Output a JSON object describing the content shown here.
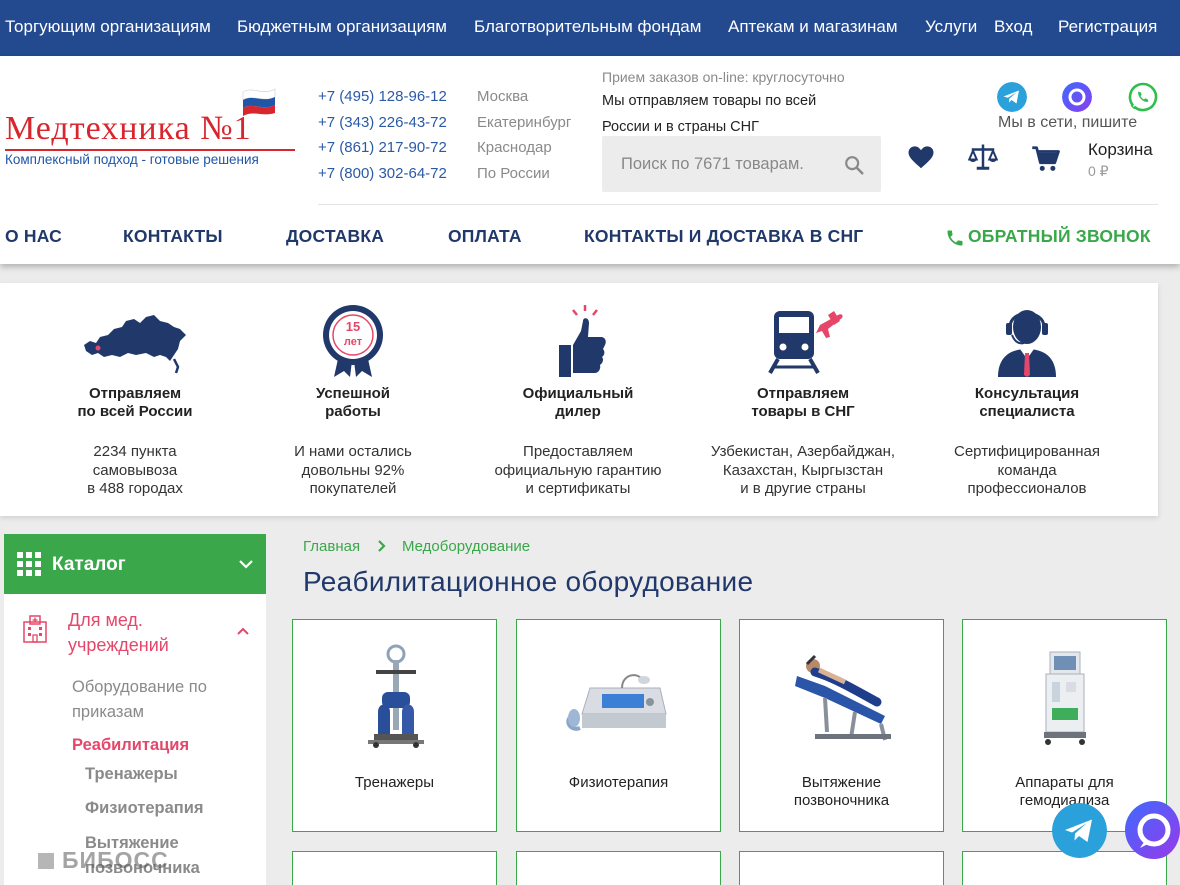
{
  "topbar": {
    "links": [
      "Торгующим организациям",
      "Бюджетным организациям",
      "Благотворительным фондам",
      "Аптекам и магазинам",
      "Услуги",
      "Вход",
      "Регистрация"
    ]
  },
  "logo": {
    "title": "Медтехника №1",
    "tagline": "Комплексный подход - готовые решения"
  },
  "phones": [
    {
      "number": "+7 (495) 128-96-12",
      "city": "Москва"
    },
    {
      "number": "+7 (343) 226-43-72",
      "city": "Екатеринбург"
    },
    {
      "number": "+7 (861) 217-90-72",
      "city": "Краснодар"
    },
    {
      "number": "+7 (800) 302-64-72",
      "city": "По России"
    }
  ],
  "orders": {
    "hint": "Прием заказов on-line: круглосуточно",
    "shipping": "Мы отправляем товары по всей России и в страны СНГ"
  },
  "search": {
    "placeholder": "Поиск по 7671 товарам."
  },
  "social": {
    "caption": "Мы в сети, пишите",
    "icons": [
      "telegram-icon",
      "max-messenger-icon",
      "whatsapp-icon"
    ]
  },
  "cart": {
    "title": "Корзина",
    "sum": "0 ₽"
  },
  "nav": {
    "about": "О НАС",
    "contacts": "КОНТАКТЫ",
    "delivery": "ДОСТАВКА",
    "payment": "ОПЛАТА",
    "cis": "КОНТАКТЫ И ДОСТАВКА В СНГ",
    "callback": "ОБРАТНЫЙ ЗВОНОК"
  },
  "features": [
    {
      "title1": "Отправляем",
      "title2": "по всей России",
      "d1": "2234 пункта",
      "d2": "самовывоза",
      "d3": "в 488 городах",
      "icon": "russia-map-icon"
    },
    {
      "title1": "Успешной",
      "title2": "работы",
      "d1": "И нами остались",
      "d2": "довольны 92%",
      "d3": "покупателей",
      "icon": "award-15-years-icon",
      "badge_top": "15",
      "badge_bottom": "лет"
    },
    {
      "title1": "Официальный",
      "title2": "дилер",
      "d1": "Предоставляем",
      "d2": "официальную гарантию",
      "d3": "и сертификаты",
      "icon": "thumbs-up-icon"
    },
    {
      "title1": "Отправляем",
      "title2": "товары в СНГ",
      "d1": "Узбекистан, Азербайджан,",
      "d2": "Казахстан, Кыргызстан",
      "d3": "и в другие страны",
      "icon": "train-plane-icon"
    },
    {
      "title1": "Консультация",
      "title2": "специалиста",
      "d1": "Сертифицированная",
      "d2": "команда",
      "d3": "профессионалов",
      "icon": "consultant-headset-icon"
    }
  ],
  "sidebar": {
    "catalog": "Каталог",
    "category1": "Для мед.",
    "category2": "учреждений",
    "items": {
      "orders1": "Оборудование по",
      "orders2": "приказам",
      "rehab": "Реабилитация",
      "trainers": "Тренажеры",
      "physio": "Физиотерапия",
      "traction1": "Вытяжение",
      "traction2": "позвоночника"
    }
  },
  "breadcrumb": {
    "home": "Главная",
    "section": "Медоборудование"
  },
  "page_title": "Реабилитационное оборудование",
  "cards": [
    {
      "line1": "Тренажеры",
      "line2": ""
    },
    {
      "line1": "Физиотерапия",
      "line2": ""
    },
    {
      "line1": "Вытяжение",
      "line2": "позвоночника"
    },
    {
      "line1": "Аппараты для",
      "line2": "гемодиализа"
    }
  ],
  "watermark": "БИБОСС",
  "colors": {
    "topbar": "#23498f",
    "accent_green": "#3aa84a",
    "accent_pink": "#e5476a",
    "nav_text": "#21386b"
  }
}
